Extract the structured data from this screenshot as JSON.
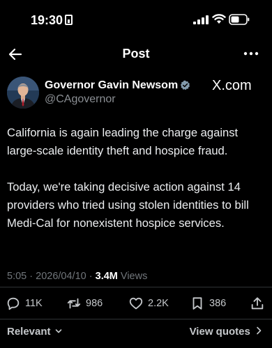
{
  "status_bar": {
    "time": "19:30",
    "sim_icon": "sim-card-icon",
    "signal_icon": "cellular-signal-icon",
    "wifi_icon": "wifi-icon",
    "battery_icon": "battery-icon"
  },
  "header": {
    "title": "Post",
    "back_icon": "arrow-left-icon",
    "more_icon": "more-horizontal-icon"
  },
  "author": {
    "name": "Governor Gavin Newsom",
    "handle": "@CAgovernor",
    "verified_icon": "verified-badge-icon",
    "source_logo": "X.com"
  },
  "tweet": {
    "text": "California is again leading the charge against large-scale identity theft and hospice fraud.\n\nToday, we're taking decisive action against 14 providers who tried using stolen identities to bill Medi-Cal for nonexistent hospice services."
  },
  "meta": {
    "time": "5:05",
    "separator": "·",
    "date": "2026/04/10",
    "views_count": "3.4M",
    "views_label": "Views"
  },
  "actions": {
    "replies": "11K",
    "reposts": "986",
    "likes": "2.2K",
    "bookmarks": "386"
  },
  "footer": {
    "sort_label": "Relevant",
    "view_quotes_label": "View quotes"
  },
  "colors": {
    "background": "#000000",
    "text": "#e7e9ea",
    "muted": "#71767b",
    "verified": "#829aab"
  }
}
